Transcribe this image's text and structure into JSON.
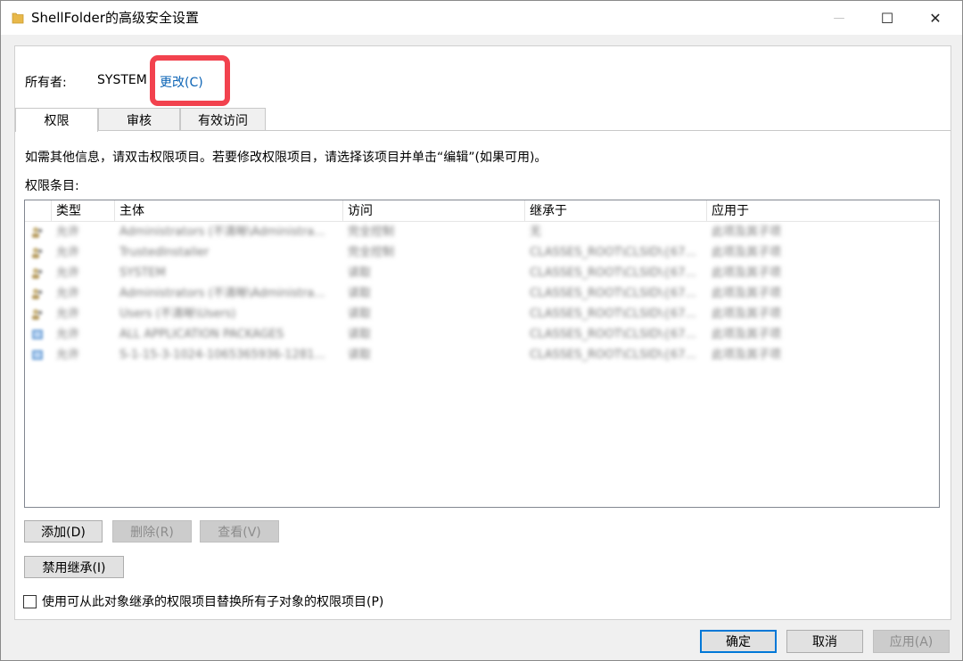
{
  "window": {
    "title": "ShellFolder的高级安全设置",
    "minimize_glyph": "—",
    "maximize_glyph": "☐",
    "close_glyph": "✕"
  },
  "owner": {
    "label": "所有者:",
    "value": "SYSTEM",
    "change_link": "更改(C)"
  },
  "tabs": [
    {
      "label": "权限",
      "active": true
    },
    {
      "label": "审核",
      "active": false
    },
    {
      "label": "有效访问",
      "active": false
    }
  ],
  "instruction": "如需其他信息，请双击权限项目。若要修改权限项目，请选择该项目并单击“编辑”(如果可用)。",
  "entries_label": "权限条目:",
  "list": {
    "columns": [
      "类型",
      "主体",
      "访问",
      "继承于",
      "应用于"
    ],
    "rows": [
      {
        "type": "允许",
        "principal": "Administrators (不清晰\\Administra...",
        "access": "完全控制",
        "inherited": "无",
        "applies": "此项及其子项",
        "icon": "user-group-icon"
      },
      {
        "type": "允许",
        "principal": "TrustedInstaller",
        "access": "完全控制",
        "inherited": "CLASSES_ROOT\\CLSID\\{67...",
        "applies": "此项及其子项",
        "icon": "user-group-icon"
      },
      {
        "type": "允许",
        "principal": "SYSTEM",
        "access": "读取",
        "inherited": "CLASSES_ROOT\\CLSID\\{67...",
        "applies": "此项及其子项",
        "icon": "user-group-icon"
      },
      {
        "type": "允许",
        "principal": "Administrators (不清晰\\Administra...",
        "access": "读取",
        "inherited": "CLASSES_ROOT\\CLSID\\{67...",
        "applies": "此项及其子项",
        "icon": "user-group-icon"
      },
      {
        "type": "允许",
        "principal": "Users (不清晰\\Users)",
        "access": "读取",
        "inherited": "CLASSES_ROOT\\CLSID\\{67...",
        "applies": "此项及其子项",
        "icon": "user-group-icon"
      },
      {
        "type": "允许",
        "principal": "ALL APPLICATION PACKAGES",
        "access": "读取",
        "inherited": "CLASSES_ROOT\\CLSID\\{67...",
        "applies": "此项及其子项",
        "icon": "app-package-icon"
      },
      {
        "type": "允许",
        "principal": "S-1-15-3-1024-1065365936-1281...",
        "access": "读取",
        "inherited": "CLASSES_ROOT\\CLSID\\{67...",
        "applies": "此项及其子项",
        "icon": "app-package-icon"
      }
    ]
  },
  "buttons": {
    "add": "添加(D)",
    "remove": "删除(R)",
    "view": "查看(V)",
    "disable_inheritance": "禁用继承(I)",
    "ok": "确定",
    "cancel": "取消",
    "apply": "应用(A)"
  },
  "replace_checkbox": {
    "label": "使用可从此对象继承的权限项目替换所有子对象的权限项目(P)",
    "checked": false
  },
  "colors": {
    "link": "#0b63b5",
    "highlight": "#f2424e",
    "accent": "#0078d7"
  }
}
